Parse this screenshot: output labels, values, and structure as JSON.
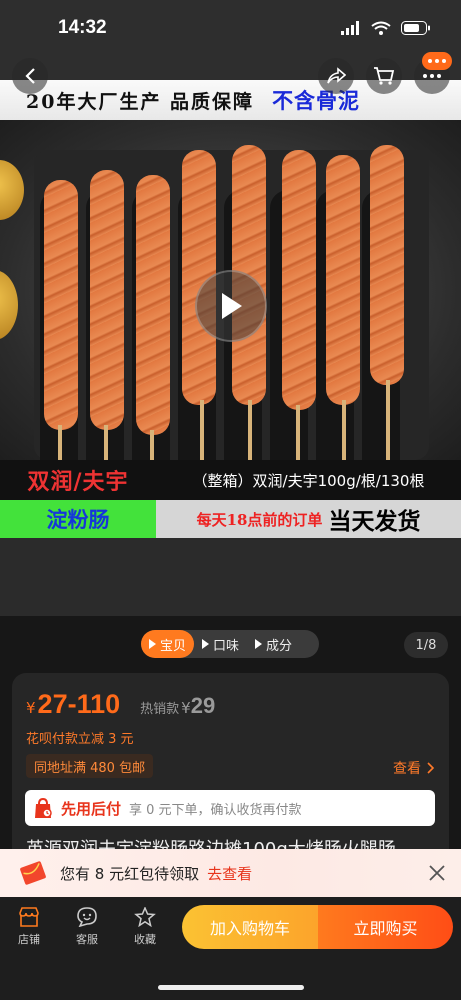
{
  "status_bar": {
    "time": "14:32"
  },
  "hero": {
    "banner_top": {
      "text": "20年大厂生产 品质保障",
      "highlight": "不含骨泥"
    },
    "banner_bottom": {
      "brand": "双润/夫宇",
      "product_type": "淀粉肠",
      "spec": "（整箱）双润/夫宇100g/根/130根",
      "cutoff": "每天18点前的订单",
      "same_day": "当天发货"
    }
  },
  "media_tabs": [
    {
      "label": "宝贝",
      "active": true
    },
    {
      "label": "口味",
      "active": false
    },
    {
      "label": "成分",
      "active": false
    }
  ],
  "page_counter": "1/8",
  "product": {
    "currency": "¥",
    "price_range": "27-110",
    "hot_label": "热销款",
    "hot_currency": "¥",
    "hot_price": "29",
    "huabei": "花呗付款立减 3 元",
    "shipping_tag": "同地址满 480 包邮",
    "view_label": "查看",
    "pay_later_title": "先用后付",
    "pay_later_desc": "享 0 元下单，确认收货再付款",
    "title": "英源双润夫宇淀粉肠路边摊100g大烤肠火腿肠"
  },
  "notice": {
    "text": "您有 8 元红包待领取",
    "link": "去查看"
  },
  "bottom_nav": {
    "shop": "店铺",
    "service": "客服",
    "favorite": "收藏",
    "add_to_cart": "加入购物车",
    "buy_now": "立即购买"
  },
  "colors": {
    "accent": "#ff6a1a",
    "cart": "#fbc233",
    "buy": "#ff4d16",
    "notice_link": "#e8341c"
  }
}
